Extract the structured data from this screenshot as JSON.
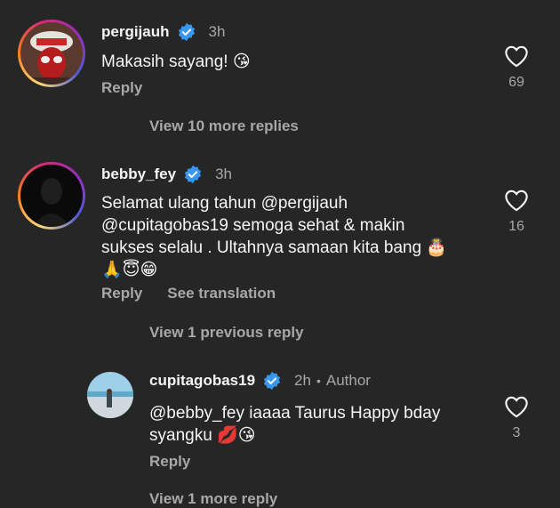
{
  "comments": [
    {
      "username": "pergijauh",
      "time": "3h",
      "text": "Makasih sayang! 😘",
      "actions": [
        "Reply"
      ],
      "likes": "69"
    },
    {
      "username": "bebby_fey",
      "time": "3h",
      "text_lines": [
        "Selamat ulang tahun @pergijauh",
        "@cupitagobas19 semoga sehat & makin",
        "sukses selalu . Ultahnya samaan kita bang 🎂",
        "🙏😇😁"
      ],
      "actions": [
        "Reply",
        "See translation"
      ],
      "likes": "16"
    },
    {
      "username": "cupitagobas19",
      "time": "2h",
      "author_badge": "Author",
      "text_lines": [
        "@bebby_fey iaaaa Taurus Happy bday",
        "syangku 💋😘"
      ],
      "actions": [
        "Reply"
      ],
      "likes": "3"
    }
  ],
  "view_more": [
    "View 10 more replies",
    "View 1 previous reply",
    "View 1 more reply"
  ],
  "colors": {
    "background": "#262626",
    "verified": "#3897f0",
    "secondary_text": "#a8a8a8"
  }
}
